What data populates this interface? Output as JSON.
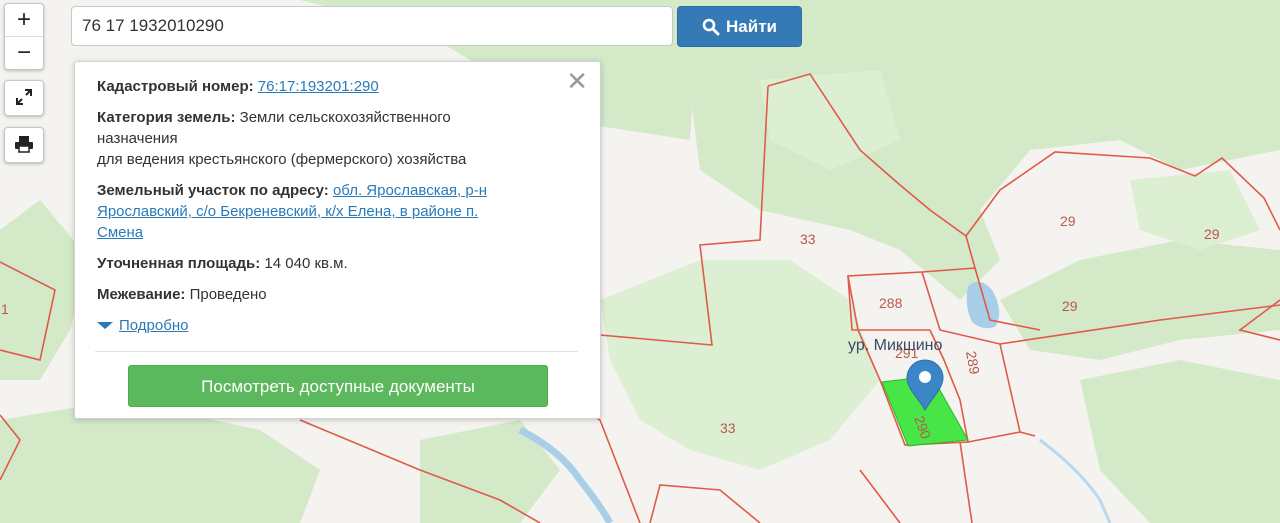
{
  "search": {
    "value": "76 17 1932010290",
    "button_label": "Найти"
  },
  "zoom": {
    "in_label": "+",
    "out_label": "−"
  },
  "controls": {
    "fullscreen_icon": "expand-icon",
    "print_icon": "printer-icon"
  },
  "popup": {
    "close_label": "✕",
    "cadastral": {
      "label": "Кадастровый номер:",
      "value": "76:17:193201:290"
    },
    "category": {
      "label": "Категория земель:",
      "value_line1": "Земли сельскохозяйственного",
      "value_line2": "назначения",
      "value_line3": "для ведения крестьянского (фермерского) хозяйства"
    },
    "address": {
      "label": "Земельный участок по адресу:",
      "value_line1": "обл. Ярославская, р-н",
      "value_line2": "Ярославский, с/о Бекреневский, к/х Елена, в районе п.",
      "value_line3": "Смена"
    },
    "area": {
      "label": "Уточненная площадь:",
      "value": "14 040 кв.м."
    },
    "survey": {
      "label": "Межевание:",
      "value": "Проведено"
    },
    "more_label": "Подробно",
    "docs_button": "Посмотреть доступные документы"
  },
  "map": {
    "place_name": "ур. Микшино",
    "parcel_labels": {
      "p33a": "33",
      "p33b": "33",
      "p29a": "29",
      "p29b": "29",
      "p29c": "29",
      "p288": "288",
      "p291": "291",
      "p289": "289",
      "p290": "290",
      "p1": "1"
    },
    "colors": {
      "parcel_border": "#e05a4a",
      "selected_fill": "#3ee63e",
      "forest": "#cfe8c4",
      "field": "#f5f3ef",
      "water": "#a9cfe8",
      "marker": "#3b86c6"
    }
  }
}
